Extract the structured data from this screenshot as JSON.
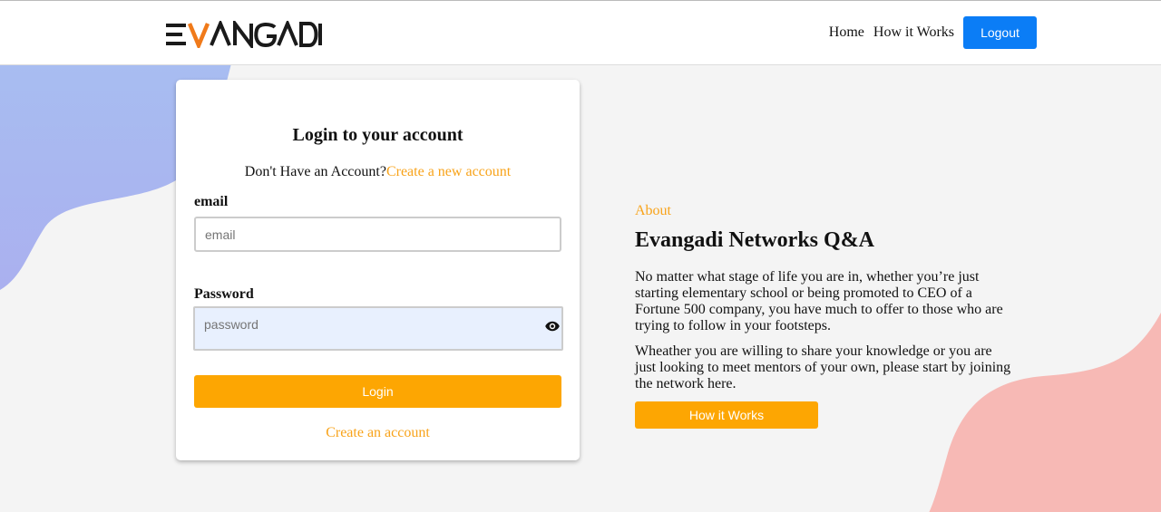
{
  "header": {
    "logo_text": "EVANGADI",
    "nav": {
      "home": "Home",
      "how_it_works": "How it Works",
      "logout": "Logout"
    }
  },
  "login": {
    "title": "Login to your account",
    "no_account_text": "Don't Have an Account?",
    "create_new_link": "Create a new account",
    "email_label": "email",
    "email_placeholder": "email",
    "password_label": "Password",
    "password_placeholder": "password",
    "login_button": "Login",
    "create_account_link": "Create an account"
  },
  "about": {
    "eyebrow": "About",
    "title": "Evangadi Networks Q&A",
    "paragraph1": "No matter what stage of life you are in, whether you’re just starting elementary school or being promoted to CEO of a Fortune 500 company, you have much to offer to those who are trying to follow in your footsteps.",
    "paragraph2": "Wheather you are willing to share your knowledge or you are just looking to meet mentors of your own, please start by joining the network here.",
    "button": "How it Works"
  },
  "colors": {
    "accent_orange": "#fda602",
    "link_orange": "#f8a31a",
    "primary_blue": "#0b7df6",
    "blob_blue": "#a9b6f0",
    "blob_pink": "#f7b8b4"
  },
  "icons": {
    "password_toggle": "eye-icon"
  }
}
